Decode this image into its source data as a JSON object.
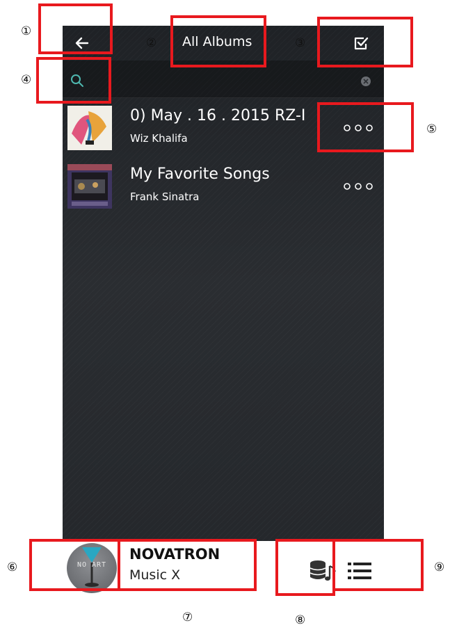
{
  "header": {
    "title": "All Albums"
  },
  "search": {
    "placeholder": ""
  },
  "albums": [
    {
      "title": "0) May . 16 . 2015 RZ-I",
      "artist": "Wiz Khalifa"
    },
    {
      "title": "My Favorite Songs",
      "artist": "Frank Sinatra"
    }
  ],
  "mini_player": {
    "art_label": "NO ART",
    "title": "NOVATRON",
    "subtitle": "Music X"
  },
  "callouts": [
    "①",
    "②",
    "③",
    "④",
    "⑤",
    "⑥",
    "⑦",
    "⑧",
    "⑨"
  ],
  "colors": {
    "highlight": "#e8191e",
    "accent": "#4fb8b0",
    "background": "#25282c"
  }
}
